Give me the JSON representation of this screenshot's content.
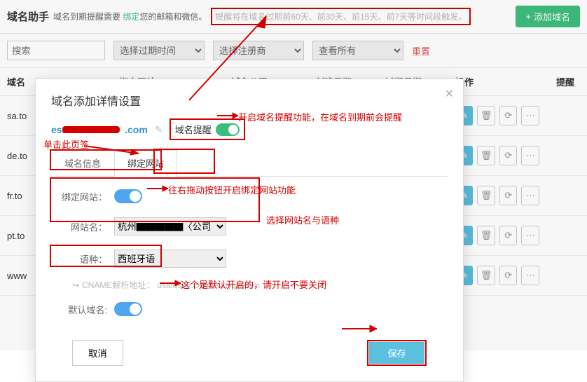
{
  "header": {
    "title": "域名助手",
    "sub_prefix": "域名到期提醒需要",
    "sub_link": "绑定",
    "sub_suffix": "您的邮箱和微信。",
    "hint": "提醒将在域名过期前60天、前30天、前15天、前7天等时间段触发。",
    "add_domain": "添加域名"
  },
  "filters": {
    "search_placeholder": "搜索",
    "expire_time": "选择过期时间",
    "registrar": "选择注册商",
    "view": "查看所有",
    "reset": "重置"
  },
  "columns": {
    "domain": "域名",
    "site": "绑定网站",
    "company": "域名公司",
    "created": "创建日期",
    "expire": "过期日期",
    "action": "操作",
    "remind": "提醒"
  },
  "rows": [
    {
      "domain": "sa.to"
    },
    {
      "domain": "de.to"
    },
    {
      "domain": "fr.to"
    },
    {
      "domain": "pt.to"
    },
    {
      "domain": "www"
    }
  ],
  "modal": {
    "title": "域名添加详情设置",
    "domain_prefix": "es.",
    "domain_suffix": ".com",
    "remind_label": "域名提醒",
    "tab_info": "域名信息",
    "tab_bind": "绑定网站",
    "bind_site_label": "绑定网站：",
    "site_name_label": "网站名：",
    "site_name_prefix": "杭州",
    "site_name_suffix": "〈公司",
    "language_label": "语种：",
    "language_value": "西班牙语",
    "cname_prefix": "CNAME解析地址：",
    "cname_value": "usalos75.cname.ldygw.com",
    "default_domain_label": "默认域名:",
    "cancel": "取消",
    "save": "保存"
  },
  "annotations": {
    "remind_note": "开启域名提醒功能，在域名到期前会提醒",
    "click_tab": "单击此页签",
    "drag_note": "往右拖动按钮开启绑定网站功能",
    "select_note": "选择网站名与语种",
    "default_note": "这个是默认开启的，请开启不要关闭"
  }
}
